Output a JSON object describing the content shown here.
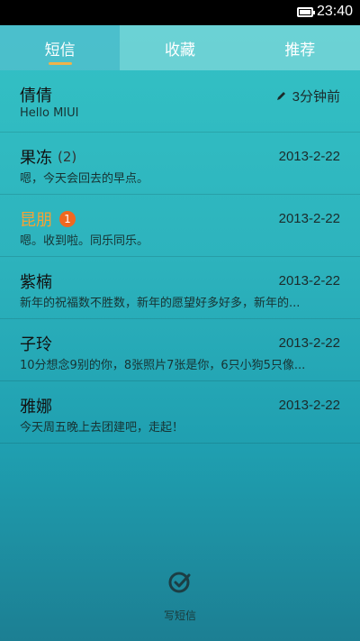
{
  "status_bar": {
    "time": "23:40"
  },
  "tabs": [
    {
      "label": "短信",
      "active": true
    },
    {
      "label": "收藏",
      "active": false
    },
    {
      "label": "推荐",
      "active": false
    }
  ],
  "conversations": [
    {
      "name": "倩倩",
      "count": "",
      "badge": "",
      "time": "3分钟前",
      "preview": "Hello MIUI",
      "editing": true
    },
    {
      "name": "果冻",
      "count": "(2)",
      "badge": "",
      "time": "2013-2-22",
      "preview": "嗯，今天会回去的早点。"
    },
    {
      "name": "昆朋",
      "count": "",
      "badge": "1",
      "time": "2013-2-22",
      "preview": "嗯。收到啦。同乐同乐。",
      "highlight": true
    },
    {
      "name": "紫楠",
      "count": "",
      "badge": "",
      "time": "2013-2-22",
      "preview": "新年的祝福数不胜数，新年的愿望好多好多，新年的..."
    },
    {
      "name": "子玲",
      "count": "",
      "badge": "",
      "time": "2013-2-22",
      "preview": "10分想念9别的你，8张照片7张是你，6只小狗5只像..."
    },
    {
      "name": "雅娜",
      "count": "",
      "badge": "",
      "time": "2013-2-22",
      "preview": "今天周五晚上去团建吧，走起！"
    }
  ],
  "compose": {
    "label": "写短信",
    "icon": "compose-icon"
  },
  "colors": {
    "accent_orange": "#f5a234",
    "badge": "#f06820"
  }
}
